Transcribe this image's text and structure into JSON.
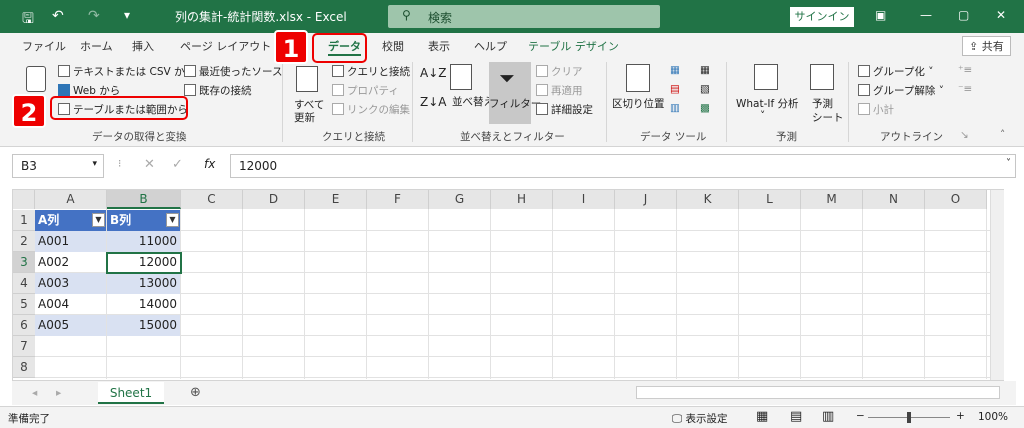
{
  "titlebar": {
    "title": "列の集計-統計関数.xlsx  -  Excel",
    "search": "検索",
    "signin": "サインイン"
  },
  "tabs": [
    "ファイル",
    "ホーム",
    "挿入",
    "ページ レイアウト",
    "データ",
    "校閲",
    "表示",
    "ヘルプ",
    "テーブル デザイン"
  ],
  "share": "共有",
  "ribbon": {
    "g1": {
      "text_csv": "テキストまたは CSV から",
      "recent": "最近使ったソース",
      "web": "Web から",
      "existing": "既存の接続",
      "table_range": "テーブルまたは範囲から",
      "label": "データの取得と変換"
    },
    "g2": {
      "refresh1": "すべて",
      "refresh2": "更新",
      "queries": "クエリと接続",
      "props": "プロパティ",
      "links": "リンクの編集",
      "label": "クエリと接続"
    },
    "g3": {
      "sort": "並べ替え",
      "filter": "フィルター",
      "clear": "クリア",
      "reapply": "再適用",
      "advanced": "詳細設定",
      "label": "並べ替えとフィルター"
    },
    "g4": {
      "split": "区切り位置",
      "label": "データ ツール"
    },
    "g5": {
      "whatif": "What-If 分析",
      "forecast1": "予測",
      "forecast2": "シート",
      "label": "予測"
    },
    "g6": {
      "group": "グループ化",
      "ungroup": "グループ解除",
      "subtotal": "小計",
      "label": "アウトライン"
    }
  },
  "badges": {
    "b1": "1",
    "b2": "2"
  },
  "formula_bar": {
    "name_box": "B3",
    "fx": "fx",
    "value": "12000"
  },
  "columns": [
    "A",
    "B",
    "C",
    "D",
    "E",
    "F",
    "G",
    "H",
    "I",
    "J",
    "K",
    "L",
    "M",
    "N",
    "O"
  ],
  "rows": [
    "1",
    "2",
    "3",
    "4",
    "5",
    "6",
    "7",
    "8"
  ],
  "table": {
    "headers": [
      "A列",
      "B列"
    ],
    "data": [
      [
        "A001",
        "11000"
      ],
      [
        "A002",
        "12000"
      ],
      [
        "A003",
        "13000"
      ],
      [
        "A004",
        "14000"
      ],
      [
        "A005",
        "15000"
      ]
    ]
  },
  "sheet_tab": "Sheet1",
  "status": {
    "ready": "準備完了",
    "display_settings": "表示設定",
    "zoom": "100%"
  }
}
